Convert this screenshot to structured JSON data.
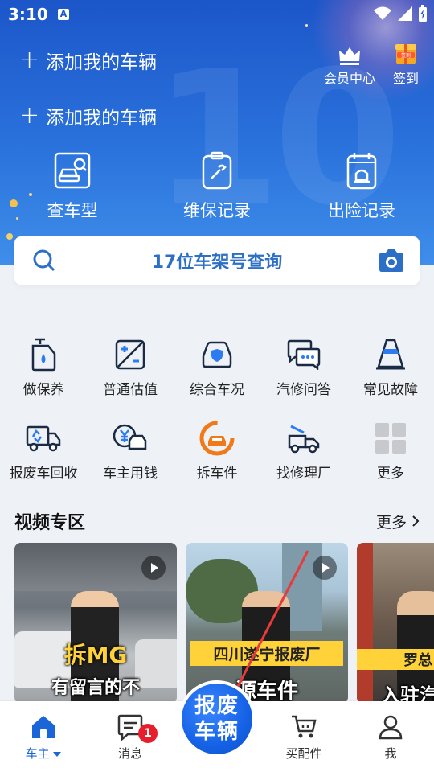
{
  "status_bar": {
    "time": "3:10",
    "a_icon_label": "A"
  },
  "header": {
    "add_vehicle_labels": [
      "添加我的车辆",
      "添加我的车辆"
    ],
    "member_center": "会员中心",
    "checkin": "签到",
    "checkin_badge": "签到"
  },
  "quick_actions": [
    {
      "label": "查车型",
      "icon": "car-search-icon"
    },
    {
      "label": "维保记录",
      "icon": "wrench-clipboard-icon"
    },
    {
      "label": "出险记录",
      "icon": "alarm-calendar-icon"
    }
  ],
  "search": {
    "label": "17位车架号查询"
  },
  "services_row1": [
    {
      "label": "做保养",
      "icon": "oil-can-icon"
    },
    {
      "label": "普通估值",
      "icon": "plus-minus-icon"
    },
    {
      "label": "综合车况",
      "icon": "car-shield-icon"
    },
    {
      "label": "汽修问答",
      "icon": "chat-bubbles-icon"
    },
    {
      "label": "常见故障",
      "icon": "traffic-cone-icon"
    }
  ],
  "services_row2": [
    {
      "label": "报废车回收",
      "icon": "recycle-truck-icon"
    },
    {
      "label": "车主用钱",
      "icon": "yen-car-icon"
    },
    {
      "label": "拆车件",
      "icon": "dismantle-car-icon"
    },
    {
      "label": "找修理厂",
      "icon": "tow-truck-icon"
    },
    {
      "label": "更多",
      "icon": "grid-more-icon"
    }
  ],
  "videos": {
    "title": "视频专区",
    "more": "更多",
    "items": [
      {
        "caption_top": "拆MG",
        "caption_bottom": "有留言的不"
      },
      {
        "caption_top": "四川遂宁报废厂",
        "caption_bottom": "源车件"
      },
      {
        "caption_top": "罗总自主",
        "caption_bottom": "入驻汽"
      }
    ]
  },
  "tabbar": {
    "items": [
      {
        "label": "车主",
        "icon": "home-icon",
        "active": true
      },
      {
        "label": "消息",
        "icon": "message-icon",
        "badge": "1"
      },
      {
        "label": "买配件",
        "icon": "cart-icon"
      },
      {
        "label": "我",
        "icon": "person-icon"
      }
    ],
    "center_button": [
      "报废",
      "车辆"
    ]
  },
  "colors": {
    "primary": "#1a66d6",
    "badge": "#e61e2b",
    "orange": "#f07a1a"
  }
}
